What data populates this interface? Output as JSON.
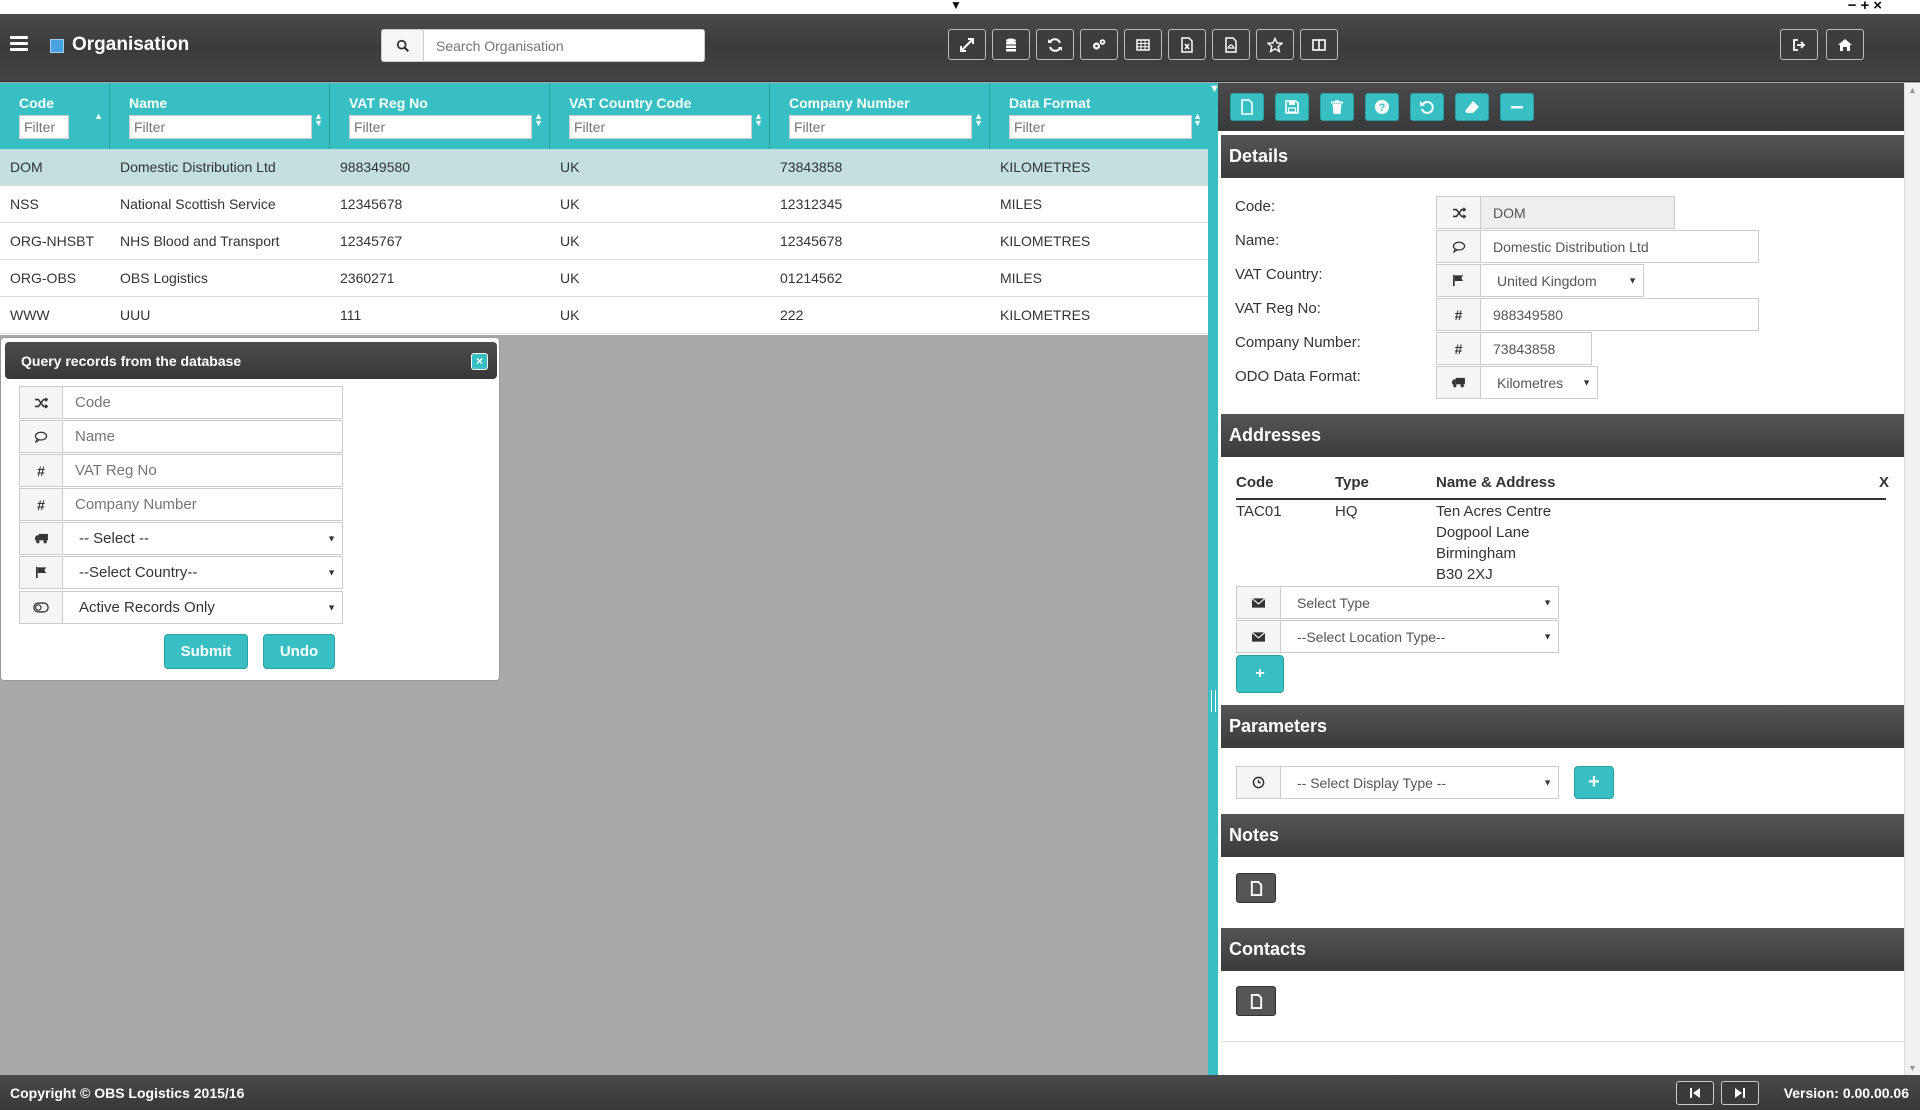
{
  "app": {
    "title": "Organisation"
  },
  "search": {
    "placeholder": "Search Organisation"
  },
  "toolbar": {
    "icons": [
      "expand-icon",
      "database-icon",
      "refresh-icon",
      "cogs-icon",
      "table-icon",
      "excel-icon",
      "pdf-icon",
      "star-icon",
      "columns-icon"
    ],
    "right_icons": [
      "logout-icon",
      "home-icon"
    ]
  },
  "grid": {
    "columns": [
      {
        "label": "Code",
        "filter_placeholder": "Filter"
      },
      {
        "label": "Name",
        "filter_placeholder": "Filter"
      },
      {
        "label": "VAT Reg No",
        "filter_placeholder": "Filter"
      },
      {
        "label": "VAT Country Code",
        "filter_placeholder": "Filter"
      },
      {
        "label": "Company Number",
        "filter_placeholder": "Filter"
      },
      {
        "label": "Data Format",
        "filter_placeholder": "Filter"
      }
    ],
    "rows": [
      [
        "DOM",
        "Domestic Distribution Ltd",
        "988349580",
        "UK",
        "73843858",
        "KILOMETRES"
      ],
      [
        "NSS",
        "National Scottish Service",
        "12345678",
        "UK",
        "12312345",
        "MILES"
      ],
      [
        "ORG-NHSBT",
        "NHS Blood and Transport",
        "12345767",
        "UK",
        "12345678",
        "KILOMETRES"
      ],
      [
        "ORG-OBS",
        "OBS Logistics",
        "2360271",
        "UK",
        "01214562",
        "MILES"
      ],
      [
        "WWW",
        "UUU",
        "111",
        "UK",
        "222",
        "KILOMETRES"
      ]
    ]
  },
  "query": {
    "title": "Query records from the database",
    "close_label": "×",
    "code_placeholder": "Code",
    "name_placeholder": "Name",
    "vat_placeholder": "VAT Reg No",
    "company_placeholder": "Company Number",
    "format_select": "-- Select --",
    "country_select": "--Select Country--",
    "active_select": "Active Records Only",
    "submit_label": "Submit",
    "undo_label": "Undo"
  },
  "details": {
    "section_title": "Details",
    "code_label": "Code:",
    "code_value": "DOM",
    "name_label": "Name:",
    "name_value": "Domestic Distribution Ltd",
    "vat_country_label": "VAT Country:",
    "vat_country_value": "United Kingdom",
    "vat_reg_label": "VAT Reg No:",
    "vat_reg_value": "988349580",
    "company_label": "Company Number:",
    "company_value": "73843858",
    "odo_label": "ODO Data Format:",
    "odo_value": "Kilometres"
  },
  "addresses": {
    "section_title": "Addresses",
    "col_code": "Code",
    "col_type": "Type",
    "col_name": "Name & Address",
    "col_x": "X",
    "row": {
      "code": "TAC01",
      "type": "HQ",
      "line1": "Ten Acres Centre",
      "line2": "Dogpool Lane",
      "line3": "Birmingham",
      "line4": "B30 2XJ"
    },
    "type_select": "Select Type",
    "location_select": "--Select Location Type--",
    "add_label": "+"
  },
  "parameters": {
    "section_title": "Parameters",
    "display_select": "-- Select Display Type --",
    "add_label": "+"
  },
  "notes": {
    "section_title": "Notes"
  },
  "contacts": {
    "section_title": "Contacts"
  },
  "footer": {
    "copyright": "Copyright © OBS Logistics 2015/16",
    "version": "Version: 0.00.00.06"
  },
  "colors": {
    "accent": "#38bfc3",
    "dark": "#3d3d3d",
    "selected_row": "#c3dfe0"
  }
}
